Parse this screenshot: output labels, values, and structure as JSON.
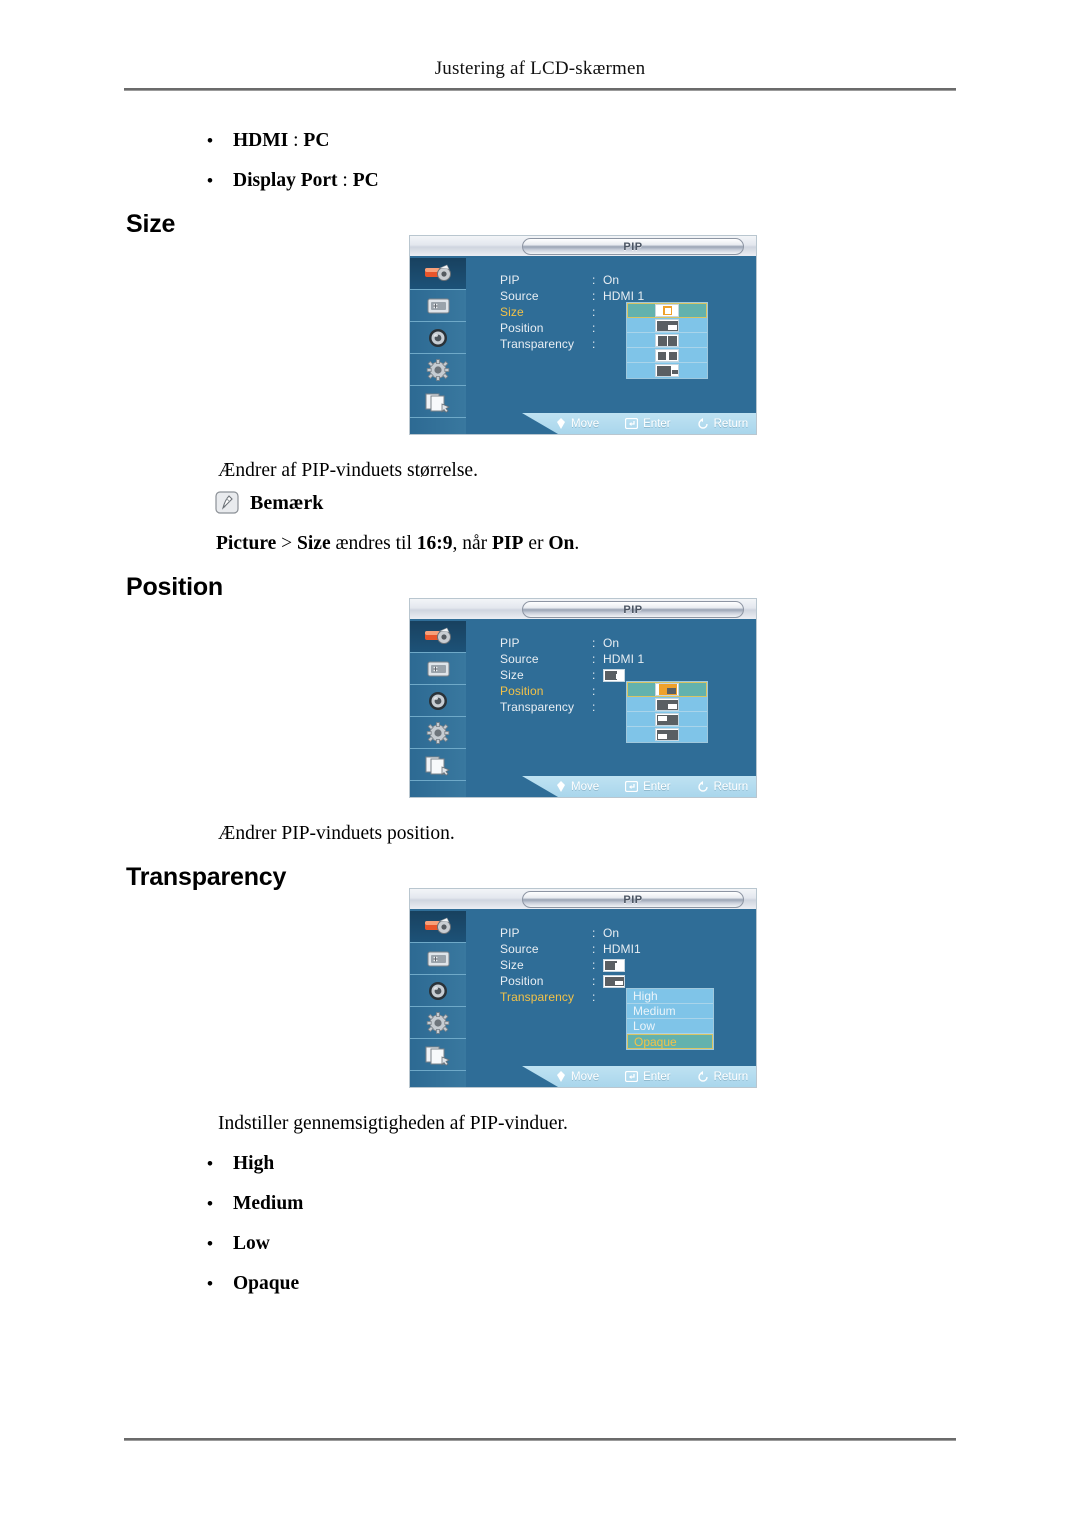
{
  "page": {
    "header_title": "Justering af LCD-skærmen"
  },
  "intro_bullets": [
    {
      "label": "HDMI",
      "separator": " : ",
      "value": "PC"
    },
    {
      "label": "Display Port",
      "separator": " : ",
      "value": "PC"
    }
  ],
  "sections": [
    {
      "id": "size",
      "heading": "Size",
      "description": "Ændrer af PIP-vinduets størrelse.",
      "note": {
        "icon": "note-pencil-icon",
        "label": "Bemærk",
        "text_parts": [
          {
            "text": "Picture",
            "bold": true
          },
          {
            "text": " > ",
            "bold": false
          },
          {
            "text": "Size",
            "bold": true
          },
          {
            "text": " ændres til ",
            "bold": false
          },
          {
            "text": "16:9",
            "bold": true
          },
          {
            "text": ", når ",
            "bold": false
          },
          {
            "text": "PIP",
            "bold": true
          },
          {
            "text": " er ",
            "bold": false
          },
          {
            "text": "On",
            "bold": true
          },
          {
            "text": ".",
            "bold": false
          }
        ],
        "text_plain": "Picture > Size ændres til 16:9, når PIP er On."
      },
      "osd": {
        "title": "PIP",
        "selected_row": "Size",
        "rows": [
          {
            "label": "PIP",
            "colon": ":",
            "value": "On",
            "type": "text"
          },
          {
            "label": "Source",
            "colon": ":",
            "value": "HDMI 1",
            "type": "text"
          },
          {
            "label": "Size",
            "colon": ":",
            "value": "",
            "type": "options"
          },
          {
            "label": "Position",
            "colon": ":",
            "value": "",
            "type": "none"
          },
          {
            "label": "Transparency",
            "colon": ":",
            "value": "",
            "type": "none"
          }
        ],
        "options": {
          "kind": "size-icons",
          "count": 5,
          "selected_index": 0,
          "items": [
            "size-large-icon",
            "size-medium-icon",
            "size-double-wide-icon",
            "size-double-equal-icon",
            "size-small-icon"
          ]
        },
        "footer": [
          {
            "icon": "move-diamond-icon",
            "label": "Move"
          },
          {
            "icon": "enter-key-icon",
            "label": "Enter"
          },
          {
            "icon": "return-circle-icon",
            "label": "Return"
          }
        ],
        "sidebar_icons": [
          "picture-paint-icon",
          "display-monitor-icon",
          "sound-speaker-icon",
          "setup-gear-icon",
          "multi-control-pip-icon"
        ],
        "sidebar_active_index": 0
      }
    },
    {
      "id": "position",
      "heading": "Position",
      "description": "Ændrer PIP-vinduets position.",
      "osd": {
        "title": "PIP",
        "selected_row": "Position",
        "rows": [
          {
            "label": "PIP",
            "colon": ":",
            "value": "On",
            "type": "text"
          },
          {
            "label": "Source",
            "colon": ":",
            "value": "HDMI 1",
            "type": "text"
          },
          {
            "label": "Size",
            "colon": ":",
            "value": "",
            "type": "glyph"
          },
          {
            "label": "Position",
            "colon": ":",
            "value": "",
            "type": "options"
          },
          {
            "label": "Transparency",
            "colon": ":",
            "value": "",
            "type": "none"
          }
        ],
        "options": {
          "kind": "position-icons",
          "count": 4,
          "selected_index": 0,
          "items": [
            "position-top-right-icon",
            "position-bottom-right-icon",
            "position-top-left-icon",
            "position-bottom-left-icon"
          ]
        },
        "footer": [
          {
            "icon": "move-diamond-icon",
            "label": "Move"
          },
          {
            "icon": "enter-key-icon",
            "label": "Enter"
          },
          {
            "icon": "return-circle-icon",
            "label": "Return"
          }
        ],
        "sidebar_icons": [
          "picture-paint-icon",
          "display-monitor-icon",
          "sound-speaker-icon",
          "setup-gear-icon",
          "multi-control-pip-icon"
        ],
        "sidebar_active_index": 0
      }
    },
    {
      "id": "transparency",
      "heading": "Transparency",
      "description": "Indstiller gennemsigtigheden af PIP-vinduer.",
      "option_bullets": [
        "High",
        "Medium",
        "Low",
        "Opaque"
      ],
      "osd": {
        "title": "PIP",
        "selected_row": "Transparency",
        "rows": [
          {
            "label": "PIP",
            "colon": ":",
            "value": "On",
            "type": "text"
          },
          {
            "label": "Source",
            "colon": ":",
            "value": "HDMI1",
            "type": "text"
          },
          {
            "label": "Size",
            "colon": ":",
            "value": "",
            "type": "glyph"
          },
          {
            "label": "Position",
            "colon": ":",
            "value": "",
            "type": "glyph"
          },
          {
            "label": "Transparency",
            "colon": ":",
            "value": "",
            "type": "options"
          }
        ],
        "options": {
          "kind": "text-list",
          "count": 4,
          "selected_index": 3,
          "items": [
            "High",
            "Medium",
            "Low",
            "Opaque"
          ]
        },
        "footer": [
          {
            "icon": "move-diamond-icon",
            "label": "Move"
          },
          {
            "icon": "enter-key-icon",
            "label": "Enter"
          },
          {
            "icon": "return-circle-icon",
            "label": "Return"
          }
        ],
        "sidebar_icons": [
          "picture-paint-icon",
          "display-monitor-icon",
          "sound-speaker-icon",
          "setup-gear-icon",
          "multi-control-pip-icon"
        ],
        "sidebar_active_index": 0
      }
    }
  ],
  "colors": {
    "osd_background": "#2f6d97",
    "osd_option_blue": "#7fc4e8",
    "osd_selected_teal": "#63b2ad",
    "osd_highlight_yellow": "#f2c248",
    "osd_text": "#e8eef3",
    "osd_footer": "#a9d6ec",
    "page_text": "#000000"
  }
}
